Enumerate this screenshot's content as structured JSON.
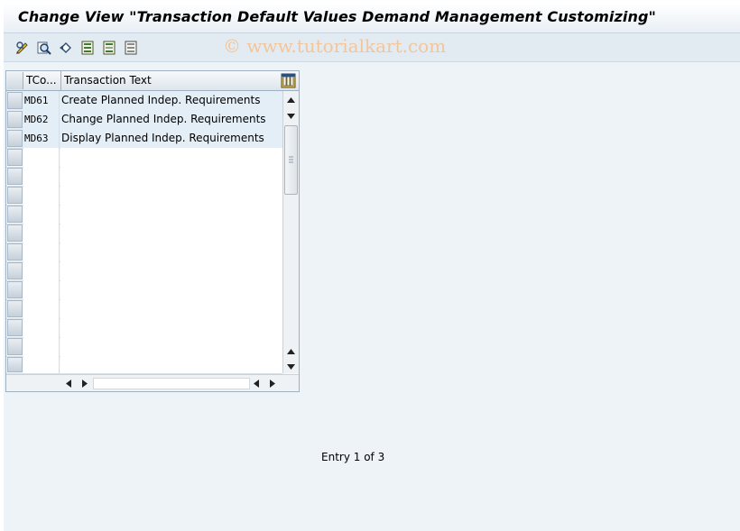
{
  "window": {
    "title": "Change View \"Transaction Default Values Demand Management Customizing\""
  },
  "toolbar": {
    "watermark": "© www.tutorialkart.com",
    "buttons": [
      {
        "icon": "display-change-icon"
      },
      {
        "icon": "find-icon"
      },
      {
        "icon": "undo-icon"
      },
      {
        "icon": "select-all-icon"
      },
      {
        "icon": "select-block-icon"
      },
      {
        "icon": "deselect-all-icon"
      }
    ]
  },
  "table": {
    "columns": [
      "TCo...",
      "Transaction Text"
    ],
    "rows": [
      {
        "tcode": "MD61",
        "text": "Create Planned Indep. Requirements"
      },
      {
        "tcode": "MD62",
        "text": "Change Planned Indep. Requirements"
      },
      {
        "tcode": "MD63",
        "text": "Display Planned Indep. Requirements"
      }
    ]
  },
  "status": {
    "entry": "Entry 1 of 3"
  },
  "colors": {
    "title_bar": "#ffffff",
    "background": "#eef3f7",
    "filled_row": "#e4eef6",
    "watermark": "#f2c59b"
  }
}
